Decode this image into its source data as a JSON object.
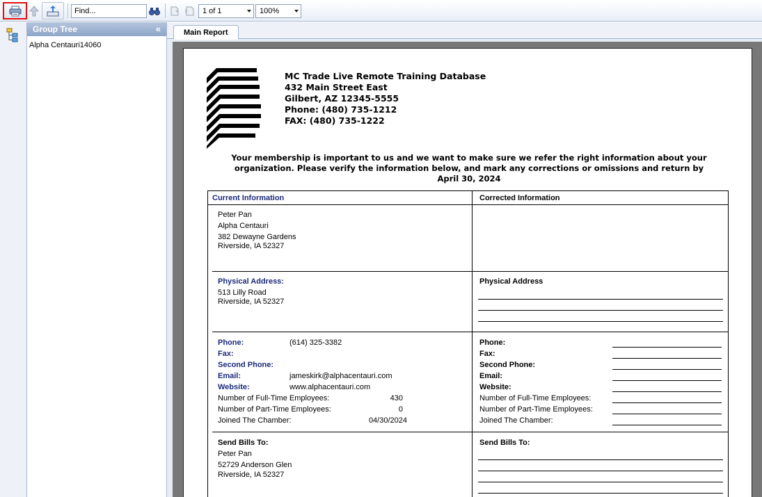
{
  "toolbar": {
    "find_placeholder": "Find...",
    "page_value": "1 of 1",
    "zoom_value": "100%"
  },
  "group_tree": {
    "title": "Group Tree",
    "collapse_glyph": "«",
    "items": [
      "Alpha Centauri14060"
    ]
  },
  "tabs": [
    "Main Report"
  ],
  "report": {
    "company": {
      "name": "MC Trade Live Remote Training Database",
      "street": "432 Main Street East",
      "city": "Gilbert, AZ 12345-5555",
      "phone": "Phone:  (480) 735-1212",
      "fax": "FAX:  (480) 735-1222"
    },
    "notice_line1": "Your membership is important to us and we want to make sure we refer the right information about your",
    "notice_line2": "organization.  Please verify the information below, and mark any corrections or omissions and return by",
    "notice_line3": "April 30, 2024",
    "current_header": "Current Information",
    "corrected_header": "Corrected Information",
    "contact": {
      "name": "Peter Pan",
      "org": "Alpha Centauri",
      "address1": "382 Dewayne Gardens",
      "address2": "Riverside, IA  52327"
    },
    "physical": {
      "label": "Physical Address:",
      "address1": "513 Lilly Road",
      "address2": "Riverside, IA  52327",
      "corrected_label": "Physical Address"
    },
    "details": {
      "phone_label": "Phone:",
      "phone_value": "(614) 325-3382",
      "fax_label": "Fax:",
      "second_phone_label": "Second Phone:",
      "email_label": "Email:",
      "email_value": "jameskirk@alphacentauri.com",
      "website_label": "Website:",
      "website_value": "www.alphacentauri.com",
      "fulltime_label": "Number of Full-Time Employees:",
      "fulltime_value": "430",
      "parttime_label": "Number of Part-Time Employees:",
      "parttime_value": "0",
      "joined_label": "Joined The Chamber:",
      "joined_value": "04/30/2024"
    },
    "bills": {
      "label": "Send Bills To:",
      "name": "Peter Pan",
      "address1": "52729 Anderson Glen",
      "address2": "Riverside, IA  52327"
    }
  },
  "colors": {
    "print_highlight": "#e01010",
    "label_navy": "#1b2a7a",
    "tree_header": "#8ea6c9",
    "canvas_gray": "#787878"
  },
  "icons": [
    "print-icon",
    "up-arrow-icon",
    "export-icon",
    "binoculars-icon",
    "prev-page-icon",
    "next-page-icon",
    "group-tree-icon"
  ]
}
